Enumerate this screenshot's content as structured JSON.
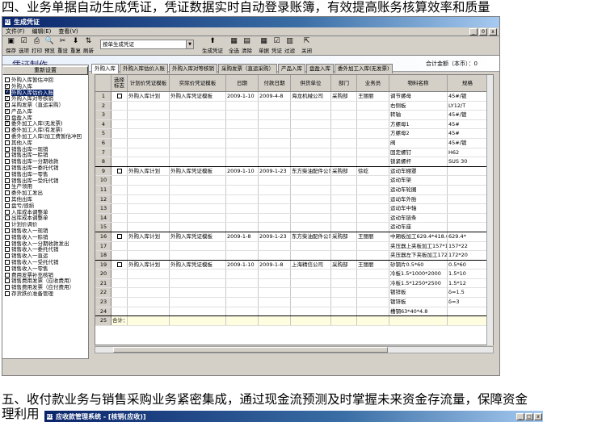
{
  "caption_top": "四、业务单据自动生成凭证，凭证数据实时自动登录账簿，有效提高账务核算效率和质量",
  "caption_bottom_1": "五、收付款业务与销售采购业务紧密集成，通过现金流预测及时掌握未来资金存流量，保障资金",
  "caption_bottom_2": "理利用",
  "window": {
    "title": "生成凭证",
    "icon": "KIS"
  },
  "menu": [
    "文件(F)",
    "编辑(E)",
    "查看(V)"
  ],
  "win_buttons": [
    "_",
    "0",
    "x"
  ],
  "toolbar": {
    "left": [
      {
        "icon": "save-icon",
        "glyph": "▣",
        "label": "保存"
      },
      {
        "icon": "options-icon",
        "glyph": "☑",
        "label": "选项"
      },
      {
        "icon": "print-icon",
        "glyph": "⎙",
        "label": "打印"
      },
      {
        "icon": "preview-icon",
        "glyph": "🔍",
        "label": "预览"
      },
      {
        "icon": "reset-icon",
        "glyph": "✂",
        "label": "重设"
      },
      {
        "icon": "reset-all-icon",
        "glyph": "⬇",
        "label": "重复"
      },
      {
        "icon": "refresh-icon",
        "glyph": "⇅",
        "label": "刷新"
      }
    ],
    "select_value": "按单生成凭证",
    "right": [
      {
        "icon": "gen-voucher-icon",
        "glyph": "⬆",
        "label": "生成凭证"
      },
      {
        "icon": "select-all-icon",
        "glyph": "▦",
        "label": "全选"
      },
      {
        "icon": "clear-icon",
        "glyph": "▤",
        "label": "清除"
      },
      {
        "icon": "bill-icon",
        "glyph": "▦",
        "label": "单据"
      },
      {
        "icon": "voucher-icon",
        "glyph": "☑",
        "label": "凭证"
      },
      {
        "icon": "filter-icon",
        "glyph": "▥",
        "label": "过滤"
      },
      {
        "icon": "close-icon",
        "glyph": "⇱",
        "label": "关闭"
      }
    ]
  },
  "banner": {
    "title": "凭证制作",
    "total": "合计金额（本币）：0"
  },
  "left_panel": {
    "reset_label": "重新设置",
    "items": [
      {
        "label": "外购入库暂估冲回",
        "checked": false
      },
      {
        "label": "外购入库",
        "checked": true
      },
      {
        "label": "外购入库估价入账",
        "checked": true,
        "highlight": true
      },
      {
        "label": "外购入库对等核销",
        "checked": true
      },
      {
        "label": "采购发票（直运采购）",
        "checked": true
      },
      {
        "label": "产品入库",
        "checked": true
      },
      {
        "label": "盘盈入库",
        "checked": true
      },
      {
        "label": "委外加工入库(无发票)",
        "checked": true
      },
      {
        "label": "委外加工入库(有发票)",
        "checked": false
      },
      {
        "label": "委外加工入库(加工费暂估冲回",
        "checked": false
      },
      {
        "label": "其他入库",
        "checked": false
      },
      {
        "label": "销售出库一现销",
        "checked": false
      },
      {
        "label": "销售出库一赊销",
        "checked": false
      },
      {
        "label": "销售出库一分期收款",
        "checked": false
      },
      {
        "label": "销售出库一委托代销",
        "checked": false
      },
      {
        "label": "销售出库一零售",
        "checked": false
      },
      {
        "label": "销售出库一受托代销",
        "checked": false
      },
      {
        "label": "生产领用",
        "checked": false
      },
      {
        "label": "委外加工发出",
        "checked": false
      },
      {
        "label": "其他出库",
        "checked": false
      },
      {
        "label": "盘亏/毁损",
        "checked": false
      },
      {
        "label": "入库成本调整单",
        "checked": false
      },
      {
        "label": "出库成本调整单",
        "checked": false
      },
      {
        "label": "计划价调价",
        "checked": false
      },
      {
        "label": "销售收入一现销",
        "checked": false
      },
      {
        "label": "销售收入一赊销",
        "checked": false
      },
      {
        "label": "销售收入一分期收款发出",
        "checked": false
      },
      {
        "label": "销售收入一委托代销",
        "checked": false
      },
      {
        "label": "销售收入一直运",
        "checked": false
      },
      {
        "label": "销售收入一受托代销",
        "checked": false
      },
      {
        "label": "销售收入一零售",
        "checked": false
      },
      {
        "label": "费用发票补充核销",
        "checked": false
      },
      {
        "label": "销售费用发票（应收费用）",
        "checked": false
      },
      {
        "label": "销售费用发票（应付费用）",
        "checked": false
      },
      {
        "label": "存货跌价准备管理",
        "checked": false
      }
    ]
  },
  "tabs": [
    "外购入库",
    "外购入库估价入账",
    "外购入库对等核销",
    "采购发票（直运采购）",
    "产品入库",
    "盘盈入库",
    "委外加工入库(无发票)"
  ],
  "table": {
    "headers": [
      "",
      "选择标志",
      "计划价凭证模板",
      "实际价凭证模板",
      "日期",
      "付款日期",
      "供货单位",
      "部门",
      "业务员",
      "物料名称",
      "规格"
    ],
    "rows": [
      {
        "n": "1",
        "c": true,
        "plan": "外购入库计划",
        "act": "外购入库凭证模板",
        "date": "2009-1-10",
        "pay": "2009-4-8",
        "sup": "海龙机械公司",
        "dept": "采购部",
        "emp": "王丽丽",
        "mat": "调节螺母",
        "spec": "45#/镀"
      },
      {
        "n": "2",
        "mat": "右侧板",
        "spec": "LY12/T"
      },
      {
        "n": "3",
        "mat": "转轴",
        "spec": "45#/镀"
      },
      {
        "n": "4",
        "mat": "方螺母1",
        "spec": "45#"
      },
      {
        "n": "5",
        "mat": "方螺母2",
        "spec": "45#"
      },
      {
        "n": "6",
        "mat": "阀",
        "spec": "45#/镀"
      },
      {
        "n": "7",
        "mat": "固定螺钉",
        "spec": "H62"
      },
      {
        "n": "8",
        "mat": "锁紧螺杆",
        "spec": "SUS 30",
        "grp": true
      },
      {
        "n": "9",
        "c": true,
        "plan": "外购入库计划",
        "act": "外购入库凭证模板",
        "date": "2009-1-10",
        "pay": "2009-1-23",
        "sup": "东方柴油配件公司",
        "dept": "采购部",
        "emp": "徐屹",
        "mat": "运动车棚罩",
        "spec": ""
      },
      {
        "n": "10",
        "mat": "运动车架",
        "spec": ""
      },
      {
        "n": "11",
        "mat": "运动车轮圈",
        "spec": ""
      },
      {
        "n": "12",
        "mat": "运动车外胎",
        "spec": ""
      },
      {
        "n": "13",
        "mat": "运动车中轴",
        "spec": ""
      },
      {
        "n": "14",
        "mat": "运动车链条",
        "spec": ""
      },
      {
        "n": "15",
        "mat": "运动车座",
        "spec": "",
        "grp": true
      },
      {
        "n": "16",
        "c": true,
        "plan": "外购入库计划",
        "act": "外购入库凭证模板",
        "date": "2009-1-8",
        "pay": "2009-1-23",
        "sup": "东方柴油配件公司",
        "dept": "采购部",
        "emp": "王丽丽",
        "mat": "中厢板加工629.4*418.6",
        "spec": "629.4*"
      },
      {
        "n": "17",
        "mat": "夹压器上夹板加工157*157",
        "spec": "157*22"
      },
      {
        "n": "18",
        "mat": "夹压器左下夹板加工172*2",
        "spec": "172*20",
        "grp": true
      },
      {
        "n": "19",
        "c": true,
        "plan": "外购入库计划",
        "act": "外购入库凭证模板",
        "date": "2009-1-10",
        "pay": "2009-1-8",
        "sup": "上海精信公司",
        "dept": "采购部",
        "emp": "王丽丽",
        "mat": "砂钢片0.5*60",
        "spec": "0.5*60"
      },
      {
        "n": "20",
        "mat": "冷板1.5*1000*2000",
        "spec": "1.5*10"
      },
      {
        "n": "21",
        "mat": "冷板1.5*1250*2500",
        "spec": "1.5*12"
      },
      {
        "n": "22",
        "mat": "镀锌板",
        "spec": "δ=1.5"
      },
      {
        "n": "23",
        "mat": "镀锌板",
        "spec": "δ=3"
      },
      {
        "n": "24",
        "mat": "槽钢63*40*4.8",
        "spec": "",
        "grp": true
      }
    ],
    "total_label": "合计：",
    "total_n": "25"
  },
  "window2": {
    "title": "应收款管理系统 - [核销(应收)]",
    "icon": "KIS"
  }
}
